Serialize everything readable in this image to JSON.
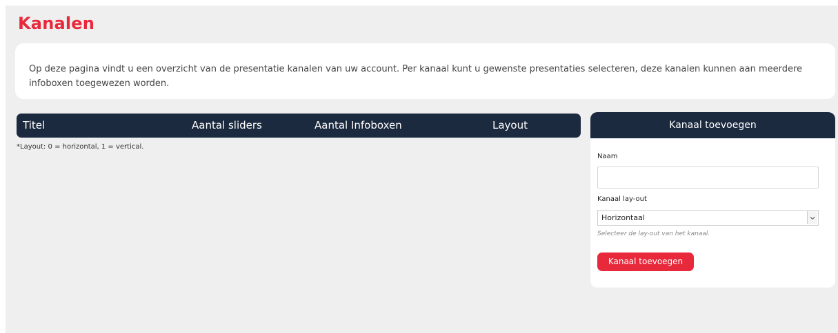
{
  "page": {
    "title": "Kanalen",
    "intro": "Op deze pagina vindt u een overzicht van de presentatie kanalen van uw account. Per kanaal kunt u gewenste presentaties selecteren, deze kanalen kunnen aan meerdere infoboxen toegewezen worden."
  },
  "table": {
    "columns": [
      "Titel",
      "Aantal sliders",
      "Aantal Infoboxen",
      "Layout"
    ],
    "rows": [],
    "note": "*Layout: 0 = horizontal, 1 = vertical."
  },
  "add_channel": {
    "header": "Kanaal toevoegen",
    "name_label": "Naam",
    "name_value": "",
    "layout_label": "Kanaal lay-out",
    "layout_selected": "Horizontaal",
    "layout_help": "Selecteer de lay-out van het kanaal.",
    "submit_label": "Kanaal toevoegen"
  },
  "icons": {
    "select_arrow": "chevron-down-icon"
  },
  "colors": {
    "accent": "#e8293b",
    "header_bg": "#1c2a3f",
    "page_bg": "#efefef",
    "card_bg": "#ffffff"
  }
}
